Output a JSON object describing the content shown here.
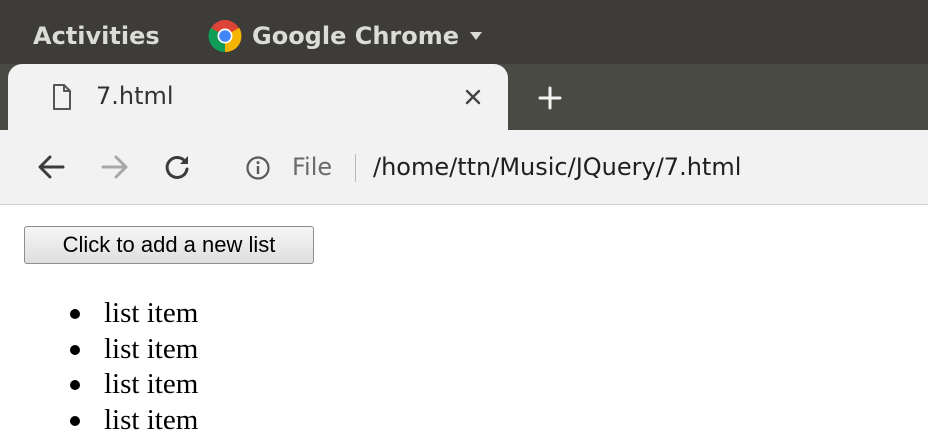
{
  "system_bar": {
    "activities_label": "Activities",
    "app_name": "Google Chrome",
    "app_icon": "chrome-logo-icon",
    "menu_icon": "caret-down-icon"
  },
  "browser": {
    "tab": {
      "title": "7.html",
      "icon": "document-icon",
      "close_icon": "close-icon"
    },
    "new_tab_icon": "plus-icon",
    "toolbar": {
      "back_icon": "arrow-left-icon",
      "forward_icon": "arrow-right-icon",
      "reload_icon": "reload-icon",
      "info_icon": "info-icon",
      "scheme_label": "File",
      "url": "/home/ttn/Music/JQuery/7.html"
    }
  },
  "page": {
    "button_label": "Click to add a new list",
    "list_items": [
      "list item",
      "list item",
      "list item",
      "list item"
    ]
  },
  "colors": {
    "topbar": "#3d3c38",
    "tabstrip": "#4a4a45",
    "chrome_ui": "#f2f2f2",
    "chrome_red": "#db4437",
    "chrome_yellow": "#f4b400",
    "chrome_green": "#0f9d58",
    "chrome_blue": "#4285f4"
  }
}
